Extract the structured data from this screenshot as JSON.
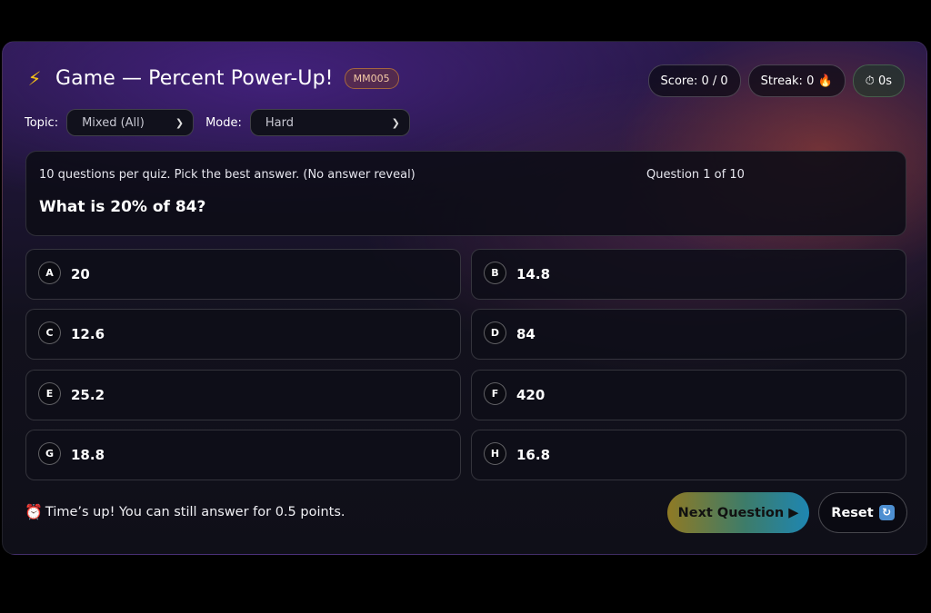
{
  "header": {
    "icon": "lightning-icon",
    "title": "Game — Percent Power-Up!",
    "code": "MM005"
  },
  "stats": {
    "score": "Score: 0 / 0",
    "streak": "Streak: 0 🔥",
    "timer": "⏱ 0s"
  },
  "controls": {
    "topic_label": "Topic:",
    "topic_value": "Mixed (All)",
    "mode_label": "Mode:",
    "mode_value": "Hard"
  },
  "question": {
    "instructions": "10 questions per quiz. Pick the best answer. (No answer reveal)",
    "counter": "Question 1 of 10",
    "text": "What is 20% of 84?"
  },
  "answers": [
    {
      "letter": "A",
      "text": "20"
    },
    {
      "letter": "B",
      "text": "14.8"
    },
    {
      "letter": "C",
      "text": "12.6"
    },
    {
      "letter": "D",
      "text": "84"
    },
    {
      "letter": "E",
      "text": "25.2"
    },
    {
      "letter": "F",
      "text": "420"
    },
    {
      "letter": "G",
      "text": "18.8"
    },
    {
      "letter": "H",
      "text": "16.8"
    }
  ],
  "footer": {
    "message_icon": "⏰",
    "message": "Time’s up! You can still answer for 0.5 points.",
    "next_label": "Next Question ▶",
    "reset_label": "Reset",
    "reset_icon": "🔄"
  },
  "colors": {
    "accent_gold": "#f5c018",
    "badge_border": "#a5663e",
    "next_gradient_start": "#8f7a24",
    "next_gradient_end": "#1e86b2"
  }
}
